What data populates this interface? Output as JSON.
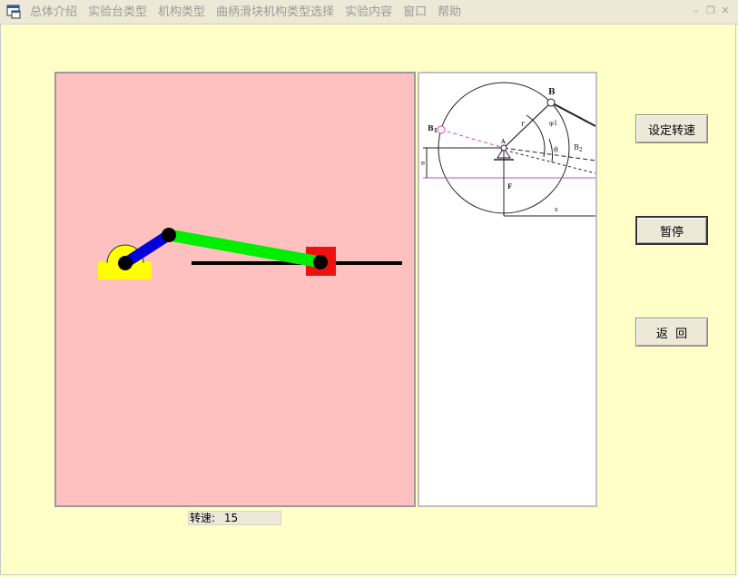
{
  "menu": {
    "items": [
      "总体介绍",
      "实验台类型",
      "机构类型",
      "曲柄滑块机构类型选择",
      "实验内容",
      "窗口",
      "帮助"
    ]
  },
  "window_controls": {
    "minimize": "–",
    "restore": "❐",
    "close": "✕"
  },
  "diagram": {
    "labels": {
      "B": "B",
      "B1_left": "B",
      "B1_left_sub": "1",
      "A": "A",
      "r": "r",
      "phi1": "φ1",
      "theta": "θ",
      "B2": "B",
      "B2_sub": "2",
      "e": "e",
      "F": "F",
      "s": "s"
    }
  },
  "buttons": {
    "set_speed": "设定转速",
    "pause": "暂停",
    "back": "返  回"
  },
  "status": {
    "speed_label": "转速:",
    "speed_value": "15"
  },
  "colors": {
    "background": "#ffffc8",
    "sim_background": "#ffc0c0",
    "crank": "#0000dd",
    "connecting_rod": "#00ee00",
    "slider": "#ee1111",
    "base": "#ffff00",
    "guide_line": "#cc44cc"
  }
}
